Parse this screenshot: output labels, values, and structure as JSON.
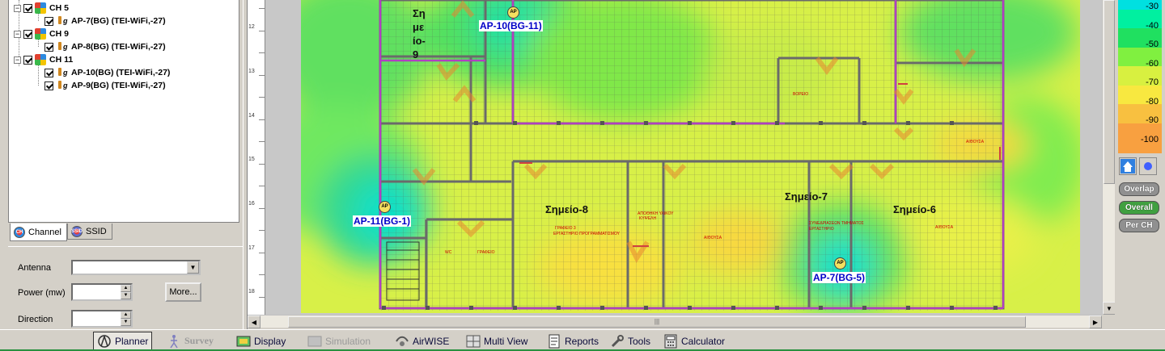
{
  "tree": {
    "items": [
      {
        "type": "channel",
        "label": "CH 5"
      },
      {
        "type": "ap",
        "label": "AP-7(BG) (TEI-WiFi,-27)"
      },
      {
        "type": "channel",
        "label": "CH 9"
      },
      {
        "type": "ap",
        "label": "AP-8(BG) (TEI-WiFi,-27)"
      },
      {
        "type": "channel",
        "label": "CH 11"
      },
      {
        "type": "ap",
        "label": "AP-10(BG) (TEI-WiFi,-27)"
      },
      {
        "type": "ap",
        "label": "AP-9(BG) (TEI-WiFi,-27)"
      }
    ],
    "expander_symbol": "−"
  },
  "tabs": [
    {
      "label": "Channel",
      "icon": "channel-tab-icon",
      "icon_text": "CH"
    },
    {
      "label": "SSID",
      "icon": "ssid-tab-icon",
      "icon_text": "SSID"
    }
  ],
  "props": {
    "antenna_label": "Antenna",
    "antenna_value": "",
    "power_label": "Power (mw)",
    "power_value": "",
    "direction_label": "Direction",
    "direction_value": "",
    "more_label": "More..."
  },
  "ruler": [
    "12",
    "13",
    "14",
    "15",
    "16",
    "17",
    "18"
  ],
  "map": {
    "ap_labels": [
      "AP-10(BG-11)",
      "AP-11(BG-1)",
      "AP-7(BG-5)"
    ],
    "ap_icon_text": "AP",
    "rooms": [
      "Σημείο-8",
      "Σημείο-7",
      "Σημείο-6"
    ],
    "room9_lines": [
      "Ση",
      "με",
      "ίο-",
      "9"
    ],
    "small_red": [
      "ΒΟΡΕΙΟ",
      "ΑΙΘΟΥΣΑ",
      "ΓΡΑΦΕΙΟ 3",
      "ΕΡΓΑΣΤΗΡΙΟ ΠΡΟΓΡΑΜΜΑΤΙΣΜΟΥ",
      "ΑΠΟΘΗΚΗ ΥΛΙΚΟΥ",
      "ΑΙΘΟΥΣΑ",
      "ΣΥΝΕΔΡΙΑΣΕΩΝ ΤΜΗΜΑΤΟΣ",
      "ΕΡΓΑΣΤΗΡΙΟ",
      "ΑΙΘΟΥΣΑ",
      "WC",
      "ΓΡΑΦΕΙΟ",
      "ΚΥΨΕΛΗ"
    ]
  },
  "legend": {
    "values": [
      "-30",
      "-40",
      "-50",
      "-60",
      "-70",
      "-80",
      "-90",
      "-100"
    ],
    "colors": [
      "#00e0e0",
      "#00f0a0",
      "#20e060",
      "#80f040",
      "#d8f040",
      "#f8e840",
      "#f8c040",
      "#f8a040"
    ],
    "buttons": [
      {
        "label": "Overlap",
        "color": "#909090"
      },
      {
        "label": "Overall",
        "color": "#40a040"
      },
      {
        "label": "Per CH",
        "color": "#909090"
      }
    ]
  },
  "scroll": {
    "up": "▲",
    "down": "▼",
    "left": "◀",
    "right": "▶",
    "grip": "|||"
  },
  "bottom": {
    "items": [
      {
        "label": "Planner",
        "state": "active",
        "icon": "planner-icon"
      },
      {
        "label": "Survey",
        "state": "disabled",
        "icon": "survey-icon"
      },
      {
        "label": "Display",
        "state": "normal",
        "icon": "display-icon"
      },
      {
        "label": "Simulation",
        "state": "disabled",
        "icon": "simulation-icon"
      },
      {
        "label": "AirWISE",
        "state": "normal",
        "icon": "airwise-icon"
      },
      {
        "label": "Multi View",
        "state": "normal",
        "icon": "multiview-icon"
      },
      {
        "label": "Reports",
        "state": "normal",
        "icon": "reports-icon"
      },
      {
        "label": "Tools",
        "state": "normal",
        "icon": "tools-icon"
      },
      {
        "label": "Calculator",
        "state": "normal",
        "icon": "calculator-icon"
      }
    ]
  }
}
